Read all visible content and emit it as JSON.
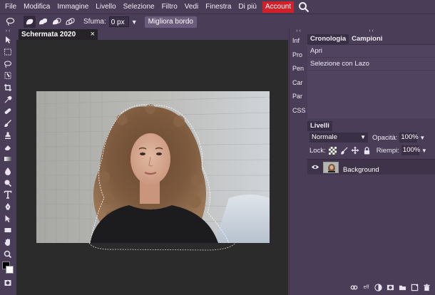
{
  "menu": {
    "items": [
      "File",
      "Modifica",
      "Immagine",
      "Livello",
      "Selezione",
      "Filtro",
      "Vedi",
      "Finestra",
      "Di più"
    ],
    "account_label": "Account"
  },
  "options": {
    "feather_label": "Sfuma:",
    "feather_value": "0  px",
    "refine_button": "Migliora bordo"
  },
  "document": {
    "tab_title": "Schermata 2020",
    "close_glyph": "×"
  },
  "side_tabs": [
    "Inf",
    "Pro",
    "Pen",
    "Car",
    "Par",
    "CSS"
  ],
  "history": {
    "tabs": [
      "Cronologia",
      "Campioni"
    ],
    "items": [
      "Apri",
      "Selezione con Lazo"
    ]
  },
  "layers": {
    "tab": "Livelli",
    "blend_mode": "Normale",
    "opacity_label": "Opacità:",
    "opacity_value": "100%",
    "lock_label": "Lock:",
    "fill_label": "Riempi:",
    "fill_value": "100%",
    "items": [
      "Background"
    ],
    "footer_eff": "eff"
  },
  "panel_collapse_glyph": "› ‹",
  "colors": {
    "chrome": "#4a3d57",
    "canvas_bg": "#2b2b2b",
    "account": "#d0202a"
  }
}
